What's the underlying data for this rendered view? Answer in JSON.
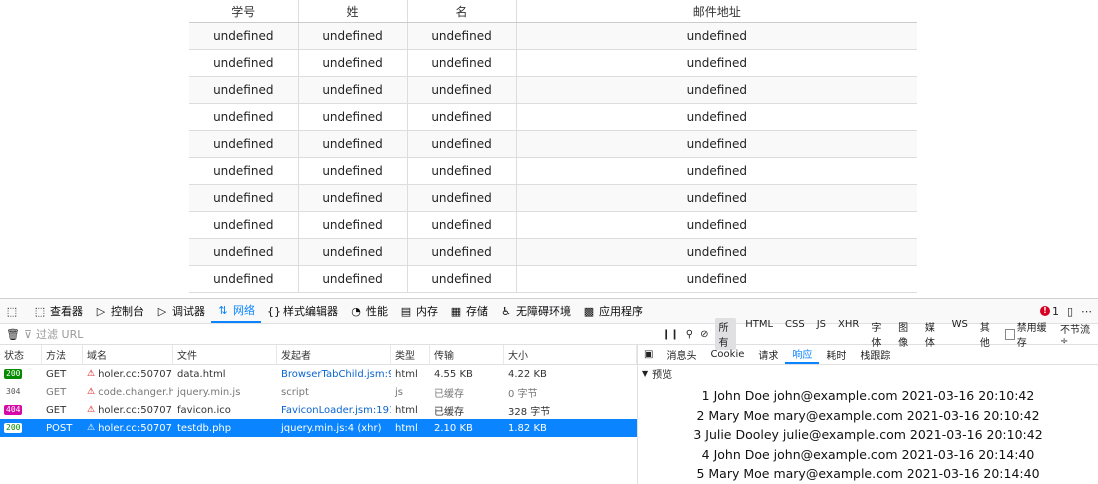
{
  "table": {
    "headers": [
      "学号",
      "姓",
      "名",
      "邮件地址"
    ],
    "rows": [
      [
        "undefined",
        "undefined",
        "undefined",
        "undefined"
      ],
      [
        "undefined",
        "undefined",
        "undefined",
        "undefined"
      ],
      [
        "undefined",
        "undefined",
        "undefined",
        "undefined"
      ],
      [
        "undefined",
        "undefined",
        "undefined",
        "undefined"
      ],
      [
        "undefined",
        "undefined",
        "undefined",
        "undefined"
      ],
      [
        "undefined",
        "undefined",
        "undefined",
        "undefined"
      ],
      [
        "undefined",
        "undefined",
        "undefined",
        "undefined"
      ],
      [
        "undefined",
        "undefined",
        "undefined",
        "undefined"
      ],
      [
        "undefined",
        "undefined",
        "undefined",
        "undefined"
      ],
      [
        "undefined",
        "undefined",
        "undefined",
        "undefined"
      ]
    ]
  },
  "devtools": {
    "tabs": [
      {
        "label": "查看器",
        "icon": "inspector-icon"
      },
      {
        "label": "控制台",
        "icon": "console-icon"
      },
      {
        "label": "调试器",
        "icon": "debugger-icon"
      },
      {
        "label": "网络",
        "icon": "network-icon"
      },
      {
        "label": "样式编辑器",
        "icon": "style-editor-icon"
      },
      {
        "label": "性能",
        "icon": "performance-icon"
      },
      {
        "label": "内存",
        "icon": "memory-icon"
      },
      {
        "label": "存储",
        "icon": "storage-icon"
      },
      {
        "label": "无障碍环境",
        "icon": "accessibility-icon"
      },
      {
        "label": "应用程序",
        "icon": "application-icon"
      }
    ],
    "error_count": "1",
    "filter_placeholder": "过滤 URL",
    "type_filters": [
      "所有",
      "HTML",
      "CSS",
      "JS",
      "XHR",
      "字体",
      "图像",
      "媒体",
      "WS",
      "其他"
    ],
    "disable_cache_label": "禁用缓存",
    "throttle_label": "不节流 ÷",
    "columns": [
      "状态",
      "方法",
      "域名",
      "文件",
      "发起者",
      "类型",
      "传输",
      "大小"
    ],
    "requests": [
      {
        "status": "200",
        "method": "GET",
        "domain": "holer.cc:50707",
        "file": "data.html",
        "initiator": "BrowserTabChild.jsm:92 (...",
        "type": "html",
        "transferred": "4.55 KB",
        "size": "4.22 KB"
      },
      {
        "status": "304",
        "method": "GET",
        "domain": "code.changer.hk",
        "file": "jquery.min.js",
        "initiator": "script",
        "type": "js",
        "transferred": "已缓存",
        "size": "0 字节"
      },
      {
        "status": "404",
        "method": "GET",
        "domain": "holer.cc:50707",
        "file": "favicon.ico",
        "initiator": "FaviconLoader.jsm:191 (i...",
        "type": "html",
        "transferred": "已缓存",
        "size": "328 字节"
      },
      {
        "status": "200",
        "method": "POST",
        "domain": "holer.cc:50707",
        "file": "testdb.php",
        "initiator": "jquery.min.js:4 (xhr)",
        "type": "html",
        "transferred": "2.10 KB",
        "size": "1.82 KB"
      }
    ],
    "detail_tabs": [
      "消息头",
      "Cookie",
      "请求",
      "响应",
      "耗时",
      "栈跟踪"
    ],
    "preview_label": "预览",
    "preview_lines": [
      "1 John Doe john@example.com 2021-03-16 20:10:42",
      "2 Mary Moe mary@example.com 2021-03-16 20:10:42",
      "3 Julie Dooley julie@example.com 2021-03-16 20:10:42",
      "4 John Doe john@example.com 2021-03-16 20:14:40",
      "5 Mary Moe mary@example.com 2021-03-16 20:14:40"
    ]
  }
}
